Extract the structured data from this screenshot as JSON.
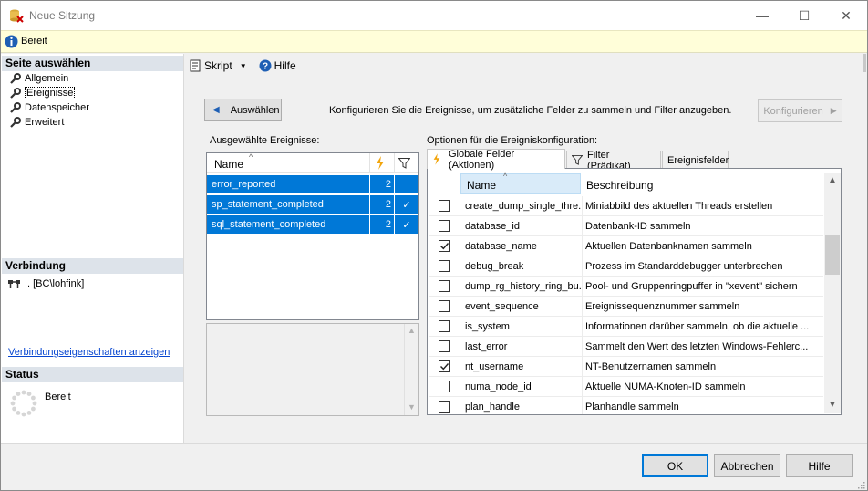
{
  "window": {
    "title": "Neue Sitzung",
    "minimize": "—",
    "maximize": "☐",
    "close": "✕"
  },
  "status_bar": {
    "text": "Bereit"
  },
  "left_panel": {
    "select_page_header": "Seite auswählen",
    "pages": [
      {
        "label": "Allgemein",
        "selected": false
      },
      {
        "label": "Ereignisse",
        "selected": true
      },
      {
        "label": "Datenspeicher",
        "selected": false
      },
      {
        "label": "Erweitert",
        "selected": false
      }
    ],
    "connection_header": "Verbindung",
    "connection_value": ". [BC\\lohfink]",
    "connection_link": "Verbindungseigenschaften anzeigen",
    "status_header": "Status",
    "status_value": "Bereit"
  },
  "toolbar": {
    "script_label": "Skript",
    "help_label": "Hilfe"
  },
  "events_page": {
    "select_button": "Auswählen",
    "instruction": "Konfigurieren Sie die Ereignisse, um zusätzliche Felder zu sammeln und Filter anzugeben.",
    "configure_button": "Konfigurieren",
    "selected_events_label": "Ausgewählte Ereignisse:",
    "events_header_name": "Name",
    "events": [
      {
        "name": "error_reported",
        "count": "2",
        "filter": ""
      },
      {
        "name": "sp_statement_completed",
        "count": "2",
        "filter": "✓"
      },
      {
        "name": "sql_statement_completed",
        "count": "2",
        "filter": "✓"
      }
    ],
    "options_label": "Optionen für die Ereigniskonfiguration:",
    "tabs": [
      {
        "label": "Globale Felder (Aktionen)",
        "active": true
      },
      {
        "label": "Filter (Prädikat)",
        "active": false
      },
      {
        "label": "Ereignisfelder",
        "active": false
      }
    ],
    "fields_header_name": "Name",
    "fields_header_desc": "Beschreibung",
    "fields": [
      {
        "name": "create_dump_single_thre...",
        "desc": "Miniabbild des aktuellen Threads erstellen",
        "checked": false
      },
      {
        "name": "database_id",
        "desc": "Datenbank-ID sammeln",
        "checked": false
      },
      {
        "name": "database_name",
        "desc": "Aktuellen Datenbanknamen sammeln",
        "checked": true
      },
      {
        "name": "debug_break",
        "desc": "Prozess im Standarddebugger unterbrechen",
        "checked": false
      },
      {
        "name": "dump_rg_history_ring_bu...",
        "desc": "Pool- und Gruppenringpuffer in \"xevent\" sichern",
        "checked": false
      },
      {
        "name": "event_sequence",
        "desc": "Ereignissequenznummer sammeln",
        "checked": false
      },
      {
        "name": "is_system",
        "desc": "Informationen darüber sammeln, ob die aktuelle ...",
        "checked": false
      },
      {
        "name": "last_error",
        "desc": "Sammelt den Wert des letzten Windows-Fehlerc...",
        "checked": false
      },
      {
        "name": "nt_username",
        "desc": "NT-Benutzernamen sammeln",
        "checked": true
      },
      {
        "name": "numa_node_id",
        "desc": "Aktuelle NUMA-Knoten-ID sammeln",
        "checked": false
      },
      {
        "name": "plan_handle",
        "desc": "Planhandle sammeln",
        "checked": false
      }
    ]
  },
  "footer": {
    "ok": "OK",
    "cancel": "Abbrechen",
    "help": "Hilfe"
  },
  "colors": {
    "selection": "#0078d7",
    "status_bar_bg": "#fffed9",
    "section_header_bg": "#dde3ea"
  }
}
